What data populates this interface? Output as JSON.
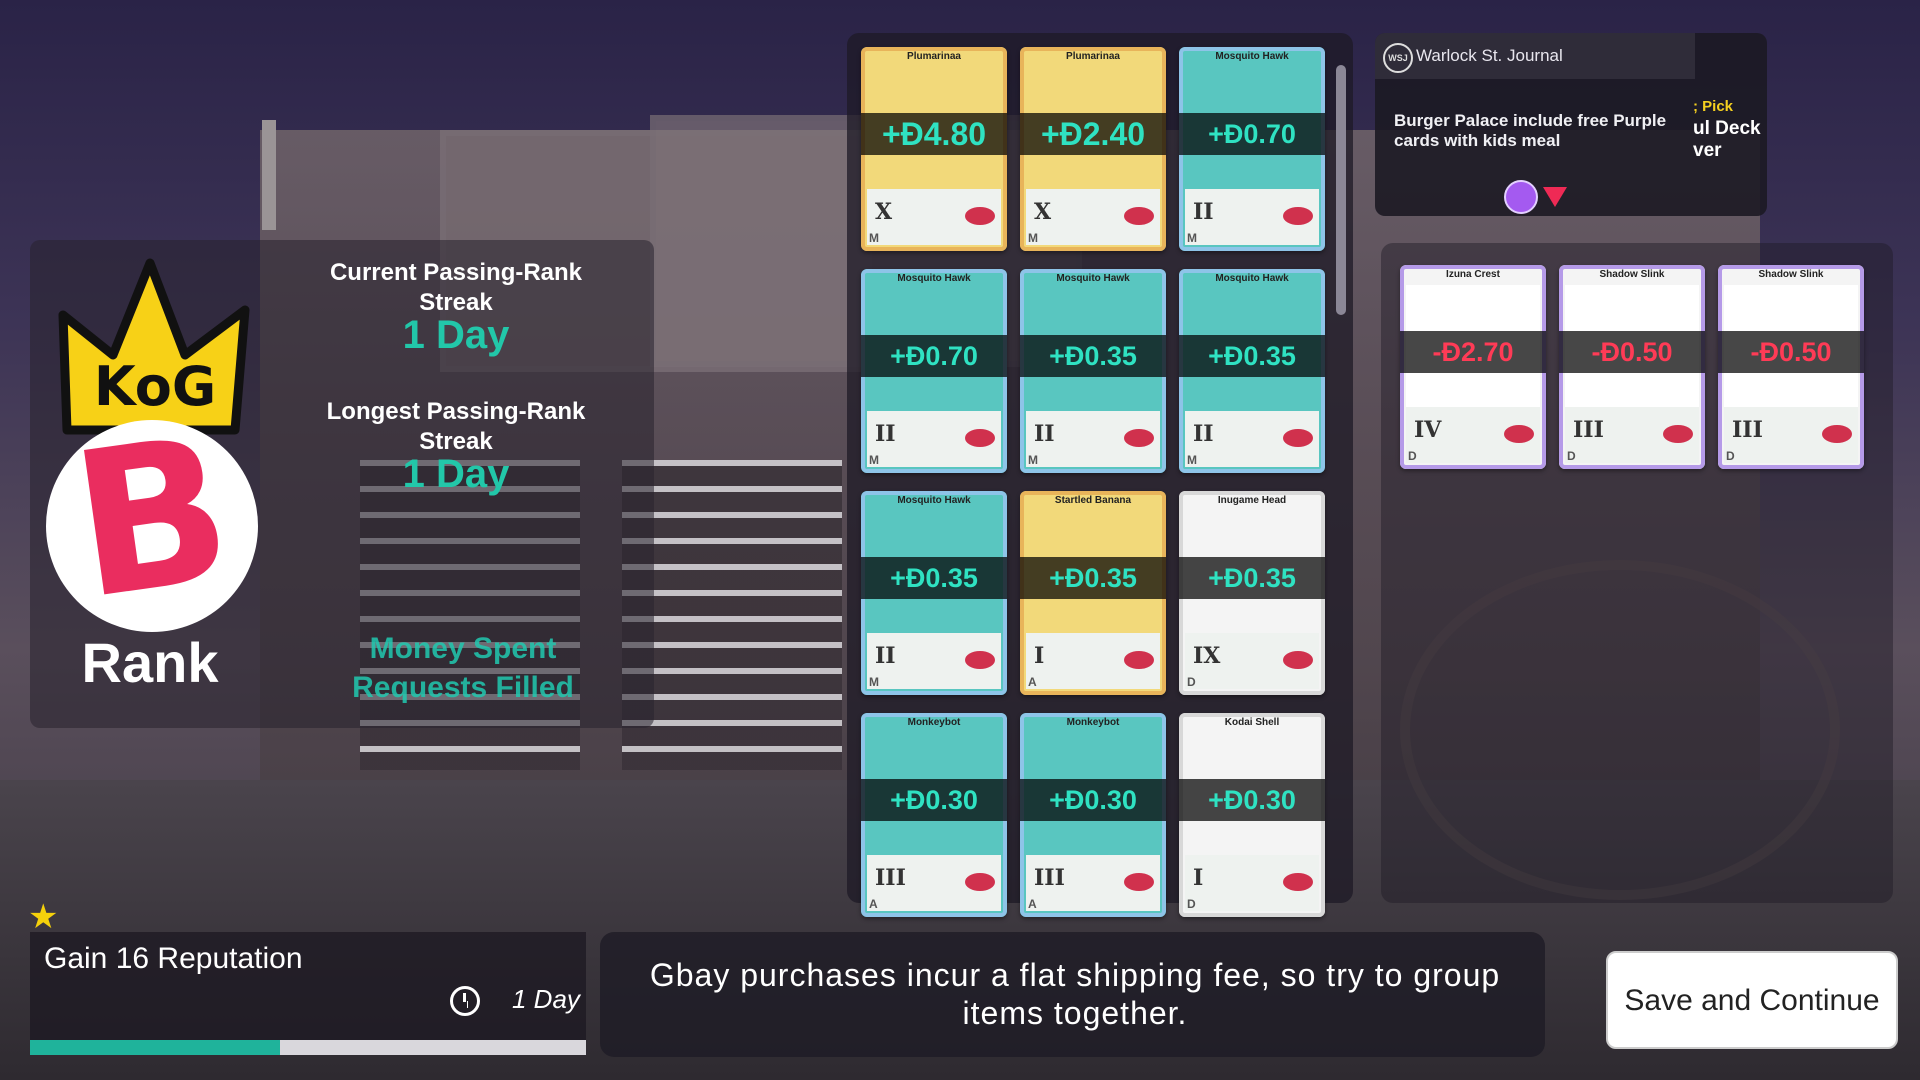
{
  "rank": {
    "crown_text": "KoG",
    "letter": "B",
    "label": "Rank"
  },
  "streaks": {
    "current_title": "Current Passing-Rank Streak",
    "current_value": "1 Day",
    "longest_title": "Longest Passing-Rank Streak",
    "longest_value": "1 Day",
    "money_spent": "Money Spent",
    "requests_filled": "Requests Filled"
  },
  "cards": [
    {
      "title": "Plumarinaa",
      "value": "+Đ4.80",
      "roman": "X",
      "rarity": "M",
      "color": "gold"
    },
    {
      "title": "Plumarinaa",
      "value": "+Đ2.40",
      "roman": "X",
      "rarity": "M",
      "color": "gold"
    },
    {
      "title": "Mosquito Hawk",
      "value": "+Đ0.70",
      "roman": "II",
      "rarity": "M",
      "color": "blue"
    },
    {
      "title": "Mosquito Hawk",
      "value": "+Đ0.70",
      "roman": "II",
      "rarity": "M",
      "color": "blue"
    },
    {
      "title": "Mosquito Hawk",
      "value": "+Đ0.35",
      "roman": "II",
      "rarity": "M",
      "color": "blue"
    },
    {
      "title": "Mosquito Hawk",
      "value": "+Đ0.35",
      "roman": "II",
      "rarity": "M",
      "color": "blue"
    },
    {
      "title": "Mosquito Hawk",
      "value": "+Đ0.35",
      "roman": "II",
      "rarity": "M",
      "color": "blue"
    },
    {
      "title": "Startled Banana",
      "value": "+Đ0.35",
      "roman": "I",
      "rarity": "A",
      "color": "gold"
    },
    {
      "title": "Inugame Head",
      "value": "+Đ0.35",
      "roman": "IX",
      "rarity": "D",
      "color": "white"
    },
    {
      "title": "Monkeybot",
      "value": "+Đ0.30",
      "roman": "III",
      "rarity": "A",
      "color": "blue"
    },
    {
      "title": "Monkeybot",
      "value": "+Đ0.30",
      "roman": "III",
      "rarity": "A",
      "color": "blue"
    },
    {
      "title": "Kodai Shell",
      "value": "+Đ0.30",
      "roman": "I",
      "rarity": "D",
      "color": "white"
    }
  ],
  "journal": {
    "logo": "WSJ",
    "title": "Warlock St. Journal",
    "body": "Burger Palace include free Purple cards with kids meal",
    "side_pick": "; Pick",
    "side_line1": "ul Deck",
    "side_line2": "ver"
  },
  "purchased": [
    {
      "title": "Izuna Crest",
      "value": "-Đ2.70",
      "roman": "IV",
      "rarity": "D"
    },
    {
      "title": "Shadow Slink",
      "value": "-Đ0.50",
      "roman": "III",
      "rarity": "D"
    },
    {
      "title": "Shadow Slink",
      "value": "-Đ0.50",
      "roman": "III",
      "rarity": "D"
    }
  ],
  "reputation": {
    "text": "Gain 16 Reputation",
    "duration": "1 Day",
    "progress": 0.45
  },
  "tip": "Gbay purchases incur a flat shipping fee, so try to group items together.",
  "save_button": "Save and Continue",
  "colors": {
    "accent_teal": "#22c7a9",
    "rank_pink": "#ea2d5f",
    "negative": "#ff3b56"
  }
}
